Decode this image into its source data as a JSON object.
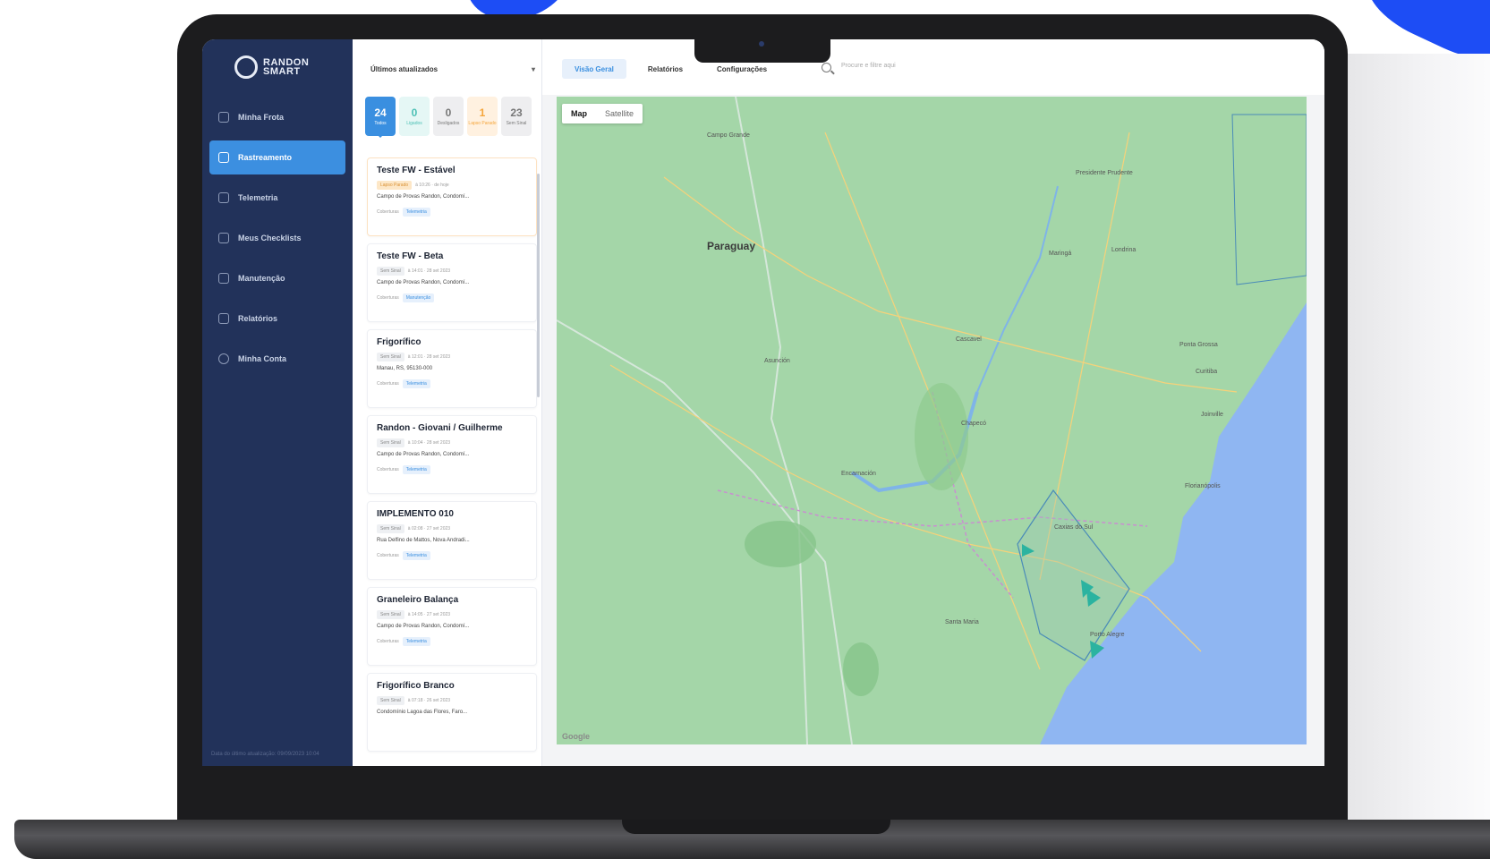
{
  "brand": {
    "name_line1": "RANDON",
    "name_line2": "SMART"
  },
  "sidebar": {
    "items": [
      {
        "label": "Minha Frota",
        "icon": "grid-icon",
        "active": false
      },
      {
        "label": "Rastreamento",
        "icon": "tracking-icon",
        "active": true
      },
      {
        "label": "Telemetria",
        "icon": "telemetry-icon",
        "active": false
      },
      {
        "label": "Meus Checklists",
        "icon": "checklist-icon",
        "active": false
      },
      {
        "label": "Manutenção",
        "icon": "wrench-icon",
        "active": false
      },
      {
        "label": "Relatórios",
        "icon": "report-icon",
        "active": false
      },
      {
        "label": "Minha Conta",
        "icon": "account-icon",
        "active": false
      }
    ],
    "footer": "Data do último atualização: 09/09/2023 10:04"
  },
  "list": {
    "sort_value": "Últimos atualizados",
    "stats": [
      {
        "value": "24",
        "label": "Todos"
      },
      {
        "value": "0",
        "label": "Ligados"
      },
      {
        "value": "0",
        "label": "Desligados"
      },
      {
        "value": "1",
        "label": "Lapso Parado"
      },
      {
        "value": "23",
        "label": "Sem Sinal"
      }
    ],
    "cards": [
      {
        "title": "Teste FW - Estável",
        "tag": "Lapso Parado",
        "meta": "à 10:26 · de hoje",
        "location": "Campo de Provas Randon, Condomí...",
        "foot_label": "Coberturas",
        "foot_tags": [
          "Telemetria"
        ]
      },
      {
        "title": "Teste FW - Beta",
        "tag": "Sem Sinal",
        "meta": "à 14:01 · 28 set 2023",
        "location": "Campo de Provas Randon, Condomí...",
        "foot_label": "Coberturas",
        "foot_tags": [
          "Manutenção"
        ]
      },
      {
        "title": "Frigorífico",
        "tag": "Sem Sinal",
        "meta": "à 12:01 · 28 set 2023",
        "location": "Manau, RS, 95130-000",
        "foot_label": "Coberturas",
        "foot_tags": [
          "Telemetria"
        ]
      },
      {
        "title": "Randon - Giovani / Guilherme",
        "tag": "Sem Sinal",
        "meta": "à 10:04 · 28 set 2023",
        "location": "Campo de Provas Randon, Condomí...",
        "foot_label": "Coberturas",
        "foot_tags": [
          "Telemetria"
        ]
      },
      {
        "title": "IMPLEMENTO 010",
        "tag": "Sem Sinal",
        "meta": "à 02:08 · 27 set 2023",
        "location": "Rua Delfino de Mattos, Nova Andradi...",
        "foot_label": "Coberturas",
        "foot_tags": [
          "Telemetria"
        ]
      },
      {
        "title": "Graneleiro Balança",
        "tag": "Sem Sinal",
        "meta": "à 14:05 · 27 set 2023",
        "location": "Campo de Provas Randon, Condomí...",
        "foot_label": "Coberturas",
        "foot_tags": [
          "Telemetria"
        ]
      },
      {
        "title": "Frigorífico Branco",
        "tag": "Sem Sinal",
        "meta": "à 07:18 · 26 set 2023",
        "location": "Condomínio Lagoa das Flores, Faro...",
        "foot_label": "Coberturas",
        "foot_tags": [
          "Telemetria"
        ]
      }
    ]
  },
  "topbar": {
    "tabs": [
      {
        "label": "Visão Geral",
        "active": true
      },
      {
        "label": "Relatórios",
        "active": false
      },
      {
        "label": "Configurações",
        "active": false
      }
    ],
    "search_placeholder": "Procure e filtre aqui"
  },
  "map": {
    "toggle": [
      "Map",
      "Satellite"
    ],
    "country_label": "Paraguay",
    "cities": [
      "Asunción",
      "Encarnación",
      "Curitiba",
      "Porto Alegre",
      "Campo Grande",
      "Santa Maria",
      "Ponta Grossa",
      "Londrina",
      "Maringá",
      "Presidente Prudente",
      "Cascavel",
      "Chapecó",
      "Joinville",
      "Florianópolis",
      "Caxias do Sul"
    ],
    "attribution": "Google"
  },
  "colors": {
    "sidebar_bg": "#22325a",
    "accent": "#3a8fe0",
    "map_land": "#a4d6a8",
    "map_water": "#8fb6f2",
    "brand_blue": "#1d4df5"
  }
}
